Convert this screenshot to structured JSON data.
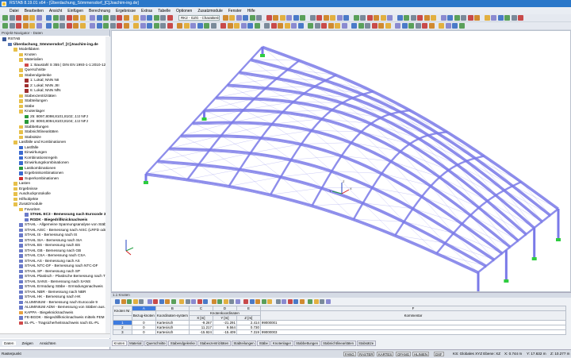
{
  "window": {
    "title": "RSTAB 8.19.01 x64 - [Überdachung_Sömmersdorf_[C]Joachim-ing.de]"
  },
  "menu": [
    "Datei",
    "Bearbeiten",
    "Ansicht",
    "Einfügen",
    "Berechnung",
    "Ergebnisse",
    "Extras",
    "Tabelle",
    "Optionen",
    "Zusatzmodule",
    "Fenster",
    "Hilfe"
  ],
  "toolbar": {
    "loadcase_combo": "RK2 - GZG - Charakteristisc"
  },
  "navigator": {
    "title": "Projekt-Navigator - Daten",
    "items": [
      {
        "l": 0,
        "t": "RSTAB",
        "c": "#3a5a9a"
      },
      {
        "l": 0,
        "t": "Überdachung_Sömmersdorf_[C]Joachim-ing.de",
        "c": "#5a7ab8",
        "b": true
      },
      {
        "l": 1,
        "t": "Modelldaten",
        "c": "#e7c04a"
      },
      {
        "l": 2,
        "t": "Knoten",
        "c": "#e7c04a"
      },
      {
        "l": 2,
        "t": "Materialien",
        "c": "#e7c04a"
      },
      {
        "l": 3,
        "t": "1: Baustahl S 355 | DIN EN 1993-1-1:2010-12",
        "c": "#d04a4a"
      },
      {
        "l": 2,
        "t": "Querschnitte",
        "c": "#e7c04a"
      },
      {
        "l": 2,
        "t": "Stabendgelenke",
        "c": "#e7c04a"
      },
      {
        "l": 3,
        "t": "1: Lokal; NNN NII",
        "c": "#a03030"
      },
      {
        "l": 3,
        "t": "2: Lokal; NNN JIII",
        "c": "#a03030"
      },
      {
        "l": 3,
        "t": "6: Lokal; NNN NfN",
        "c": "#a03030"
      },
      {
        "l": 2,
        "t": "Stabexzentrizitäten",
        "c": "#e7c04a"
      },
      {
        "l": 2,
        "t": "Stabteilungen",
        "c": "#e7c04a"
      },
      {
        "l": 2,
        "t": "Stäbe",
        "c": "#e7c04a"
      },
      {
        "l": 2,
        "t": "Knotenlager",
        "c": "#e7c04a"
      },
      {
        "l": 3,
        "t": "25: 8097,8098,8101,8102; JJJ NFJ",
        "c": "#2a9a3a"
      },
      {
        "l": 3,
        "t": "26: 8093,8094,8103,8104; JJJ NFJ",
        "c": "#2a9a3a"
      },
      {
        "l": 2,
        "t": "Stabbettungen",
        "c": "#e7c04a"
      },
      {
        "l": 2,
        "t": "Stabnichtlinearitäten",
        "c": "#e7c04a"
      },
      {
        "l": 2,
        "t": "Stabsätze",
        "c": "#e7c04a"
      },
      {
        "l": 1,
        "t": "Lastfälle und Kombinationen",
        "c": "#e7c04a"
      },
      {
        "l": 2,
        "t": "Lastfälle",
        "c": "#3a6ad0"
      },
      {
        "l": 2,
        "t": "Einwirkungen",
        "c": "#3a6ad0"
      },
      {
        "l": 2,
        "t": "Kombinationsregeln",
        "c": "#3a6ad0"
      },
      {
        "l": 2,
        "t": "Einwirkungskombinationen",
        "c": "#3a6ad0"
      },
      {
        "l": 2,
        "t": "Lastkombinationen",
        "c": "#2a9a3a"
      },
      {
        "l": 2,
        "t": "Ergebniskombinationen",
        "c": "#3a6ad0"
      },
      {
        "l": 2,
        "t": "Superkombinationen",
        "c": "#d03030"
      },
      {
        "l": 1,
        "t": "Lasten",
        "c": "#e7c04a"
      },
      {
        "l": 1,
        "t": "Ergebnisse",
        "c": "#e7c04a"
      },
      {
        "l": 1,
        "t": "Ausdruckprotokolle",
        "c": "#e7c04a"
      },
      {
        "l": 1,
        "t": "Hilfsobjekte",
        "c": "#e7c04a"
      },
      {
        "l": 1,
        "t": "Zusatzmodule",
        "c": "#e7c04a"
      },
      {
        "l": 2,
        "t": "Favoriten",
        "c": "#e7c04a"
      },
      {
        "l": 3,
        "t": "STAHL EC3 - Bemessung nach Eurocode 3",
        "c": "#6a7ac8",
        "b": true
      },
      {
        "l": 3,
        "t": "RGDK - Biegedrillknicknachweis",
        "c": "#6a7ac8",
        "b": true
      },
      {
        "l": 2,
        "t": "STAHL - Allgemeine Spannungsanalyse von Stäben",
        "c": "#6a7ac8"
      },
      {
        "l": 2,
        "t": "STAHL AISC - Bemessung nach AISC (LRFD oder A",
        "c": "#6a7ac8"
      },
      {
        "l": 2,
        "t": "STAHL IS - Bemessung nach IS",
        "c": "#6a7ac8"
      },
      {
        "l": 2,
        "t": "STAHL SIA - Bemessung nach SIA",
        "c": "#6a7ac8"
      },
      {
        "l": 2,
        "t": "STAHL BS - Bemessung nach BS",
        "c": "#6a7ac8"
      },
      {
        "l": 2,
        "t": "STAHL GB - Bemessung nach GB",
        "c": "#6a7ac8"
      },
      {
        "l": 2,
        "t": "STAHL CSA - Bemessung nach CSA",
        "c": "#6a7ac8"
      },
      {
        "l": 2,
        "t": "STAHL AS - Bemessung nach AS",
        "c": "#6a7ac8"
      },
      {
        "l": 2,
        "t": "STAHL NTC-DF - Bemessung nach NTC-DF",
        "c": "#6a7ac8"
      },
      {
        "l": 2,
        "t": "STAHL SP - Bemessung nach SP",
        "c": "#6a7ac8"
      },
      {
        "l": 2,
        "t": "STAHL Plastisch - Plastische Bemessung nach TSV",
        "c": "#6a7ac8"
      },
      {
        "l": 2,
        "t": "STAHL SANS - Bemessung nach SANS",
        "c": "#6a7ac8"
      },
      {
        "l": 2,
        "t": "STAHL Ermüdung Stäbe - Ermüdungsnachweis",
        "c": "#6a7ac8"
      },
      {
        "l": 2,
        "t": "STAHL NBR - Bemessung nach NBR",
        "c": "#6a7ac8"
      },
      {
        "l": 2,
        "t": "STAHL HK - Bemessung nach HK",
        "c": "#6a7ac8"
      },
      {
        "l": 2,
        "t": "ALUMINIUM - Bemessung nach Eurocode 9",
        "c": "#6a7ac8"
      },
      {
        "l": 2,
        "t": "ALUMINIUM ADM - Bemessung von Stäben aus A",
        "c": "#6a7ac8"
      },
      {
        "l": 2,
        "t": "KAPPA - Biegeknicknachweis",
        "c": "#e7a040"
      },
      {
        "l": 2,
        "t": "FE-BGDK - Biegedrillknicknachweis mittels FEM",
        "c": "#6a7ac8"
      },
      {
        "l": 2,
        "t": "EL-PL - Tragsicherheitsnachweis nach EL-PL",
        "c": "#d04a4a"
      }
    ],
    "tabs": [
      "Daten",
      "Zeigen",
      "Ansichten"
    ]
  },
  "view": {
    "axis_labels": {
      "x": "X",
      "y": "Y",
      "z": "Z"
    },
    "member_color": "#7a7ae8",
    "support_color": "#2ecc40"
  },
  "table": {
    "title": "1.1 Knoten",
    "col_letters": [
      "A",
      "B",
      "C",
      "D",
      "E",
      "F"
    ],
    "headers": {
      "nr": "Knoten Nr.",
      "ref": "Bezug-knoten",
      "sys": "Koordinaten-system",
      "coords": "Knotenkoordinaten",
      "x": "X [m]",
      "y": "Y [m]",
      "z": "Z [m]",
      "comment": "Kommentar"
    },
    "rows": [
      {
        "nr": "1",
        "ref": "0",
        "sys": "Kartesisch",
        "x": "-9.267",
        "y": "-21.291",
        "z": "2.414",
        "comment": "99000001"
      },
      {
        "nr": "2",
        "ref": "0",
        "sys": "Kartesisch",
        "x": "11.217",
        "y": "9.564",
        "z": "0.730",
        "comment": ""
      },
      {
        "nr": "3",
        "ref": "0",
        "sys": "Kartesisch",
        "x": "-15.924",
        "y": "-15.409",
        "z": "7.319",
        "comment": "99000003"
      }
    ],
    "tabs": [
      "Knoten",
      "Material",
      "Querschnitte",
      "Stabendgelenke",
      "Stabexzentrizitäten",
      "Stabteilungen",
      "Stäbe",
      "Knotenlager",
      "Stabbettungen",
      "Stabnichtlinearitäten",
      "Stabsätze"
    ]
  },
  "status": {
    "left": "Rasterpunkt",
    "toggles": [
      "FANG",
      "RASTER",
      "KARTES",
      "OFANG",
      "HLINIEN",
      "DXF"
    ],
    "cs": "KS: Globales XYZ Ebene: XZ",
    "x": "X: 0.744 m",
    "y": "Y: 17.632 m",
    "z": "Z: 10.277 m"
  }
}
